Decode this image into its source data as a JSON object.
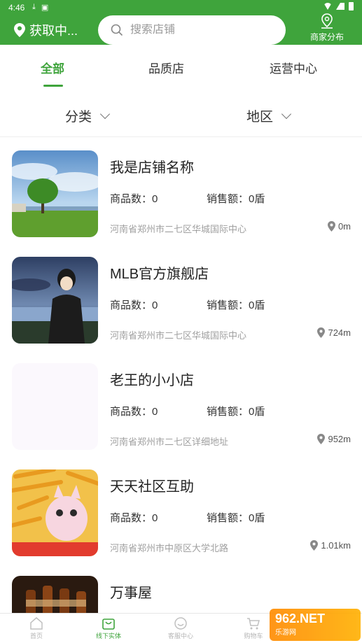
{
  "status_bar": {
    "time": "4:46"
  },
  "header": {
    "location_label": "获取中...",
    "search_placeholder": "搜索店铺",
    "distribution_label": "商家分布"
  },
  "tabs": [
    {
      "label": "全部",
      "active": true
    },
    {
      "label": "品质店",
      "active": false
    },
    {
      "label": "运营中心",
      "active": false
    }
  ],
  "filters": {
    "category_label": "分类",
    "region_label": "地区"
  },
  "shops": [
    {
      "name": "我是店铺名称",
      "goods_count": "商品数：0",
      "sales": "销售额：0盾",
      "address": "河南省郑州市二七区华城国际中心",
      "distance": "0m",
      "image": "landscape-tree"
    },
    {
      "name": "MLB官方旗舰店",
      "goods_count": "商品数：0",
      "sales": "销售额：0盾",
      "address": "河南省郑州市二七区华城国际中心",
      "distance": "724m",
      "image": "boy-seaside"
    },
    {
      "name": "老王的小小店",
      "goods_count": "商品数：0",
      "sales": "销售额：0盾",
      "address": "河南省郑州市二七区详细地址",
      "distance": "952m",
      "image": "blank"
    },
    {
      "name": "天天社区互助",
      "goods_count": "商品数：0",
      "sales": "销售额：0盾",
      "address": "河南省郑州市中原区大学北路",
      "distance": "1.01km",
      "image": "snack-cat"
    },
    {
      "name": "万事屋",
      "image": "bottles"
    }
  ],
  "bottom_nav": [
    {
      "label": "首页",
      "icon": "home-icon",
      "active": false
    },
    {
      "label": "线下实体",
      "icon": "shop-bag-icon",
      "active": true
    },
    {
      "label": "客服中心",
      "icon": "smile-icon",
      "active": false
    },
    {
      "label": "购物车",
      "icon": "cart-icon",
      "active": false
    }
  ],
  "watermark": {
    "line1": "962.NET",
    "line2": "乐游网"
  },
  "colors": {
    "brand_green": "#3fa43c"
  }
}
